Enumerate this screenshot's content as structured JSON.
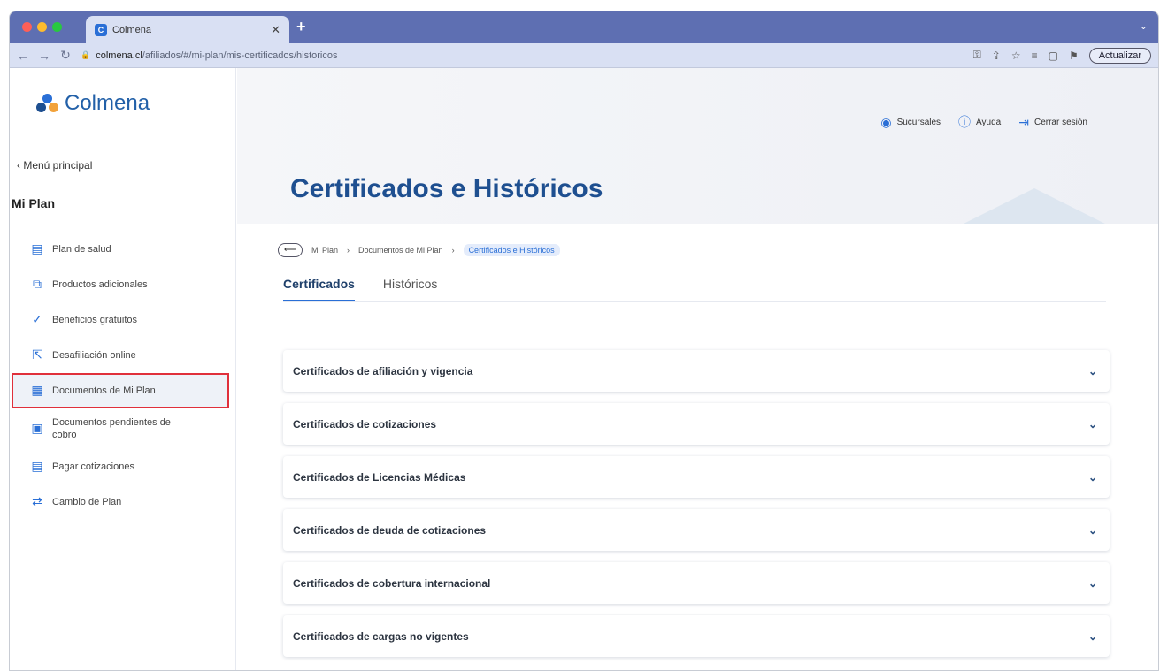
{
  "browser": {
    "tab_title": "Colmena",
    "url_prefix": "colmena.cl",
    "url_path": "/afiliados/#/mi-plan/mis-certificados/historicos",
    "update_label": "Actualizar",
    "colors": {
      "tabbar": "#5e6fb2",
      "addrbar": "#d9e0f3"
    }
  },
  "sidebar": {
    "logo_text": "Colmena",
    "back_label": "‹ Menú principal",
    "section_title": "Mi Plan",
    "items": [
      {
        "label": "Plan de salud",
        "icon": "document-icon"
      },
      {
        "label": "Productos adicionales",
        "icon": "products-icon"
      },
      {
        "label": "Beneficios gratuitos",
        "icon": "check-circle-icon"
      },
      {
        "label": "Desafiliación online",
        "icon": "exit-icon"
      },
      {
        "label": "Documentos de Mi Plan",
        "icon": "folder-icon",
        "active": true
      },
      {
        "label": "Documentos pendientes de cobro",
        "icon": "pending-docs-icon"
      },
      {
        "label": "Pagar cotizaciones",
        "icon": "pay-icon"
      },
      {
        "label": "Cambio de Plan",
        "icon": "change-plan-icon"
      }
    ]
  },
  "header": {
    "links": [
      {
        "label": "Sucursales",
        "icon": "location-icon"
      },
      {
        "label": "Ayuda",
        "icon": "info-icon"
      },
      {
        "label": "Cerrar sesión",
        "icon": "logout-icon"
      }
    ],
    "page_title": "Certificados e Históricos"
  },
  "breadcrumb": {
    "back_icon": "arrow-left-icon",
    "items": [
      "Mi Plan",
      "Documentos de Mi Plan",
      "Certificados e Históricos"
    ]
  },
  "tabs": [
    {
      "label": "Certificados",
      "active": true
    },
    {
      "label": "Históricos",
      "active": false
    }
  ],
  "accordion": [
    "Certificados de afiliación y vigencia",
    "Certificados de cotizaciones",
    "Certificados de Licencias Médicas",
    "Certificados de deuda de cotizaciones",
    "Certificados de cobertura internacional",
    "Certificados de cargas no vigentes"
  ]
}
